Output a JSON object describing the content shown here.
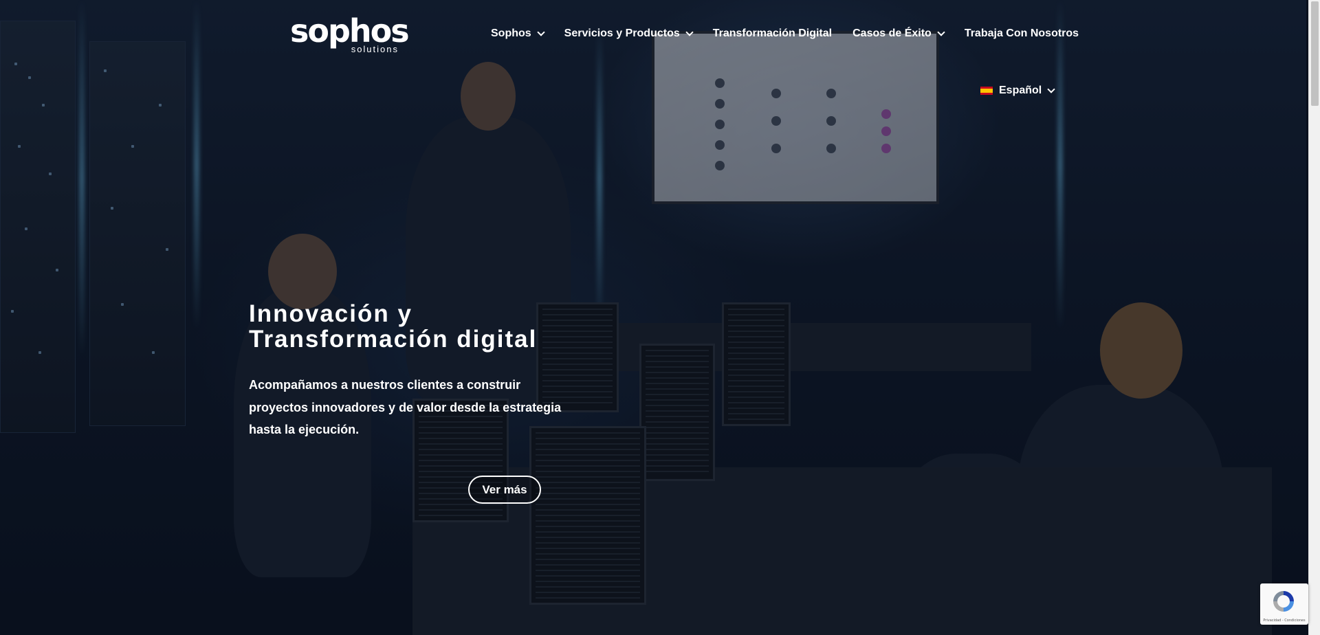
{
  "logo": {
    "word": "sophos",
    "sub": "solutions"
  },
  "nav": {
    "items": [
      {
        "label": "Sophos",
        "dropdown": true
      },
      {
        "label": "Servicios y Productos",
        "dropdown": true
      },
      {
        "label": "Transformación Digital",
        "dropdown": false
      },
      {
        "label": "Casos de Éxito",
        "dropdown": true
      },
      {
        "label": "Trabaja Con Nosotros",
        "dropdown": false
      }
    ],
    "language": {
      "label": "Español",
      "flag": "es-flag-icon"
    }
  },
  "hero": {
    "title_line1": "Innovación y",
    "title_line2": "Transformación digital",
    "text_line1": "Acompañamos a nuestros clientes a construir",
    "text_line2": "proyectos innovadores y de valor desde la estrategia",
    "text_line3": "hasta la ejecución.",
    "cta_label": "Ver más"
  },
  "recaptcha": {
    "links": "Privacidad - Condiciones"
  },
  "colors": {
    "text": "#ffffff",
    "background": "#0b1422",
    "accent_glow": "#78d2ff"
  }
}
